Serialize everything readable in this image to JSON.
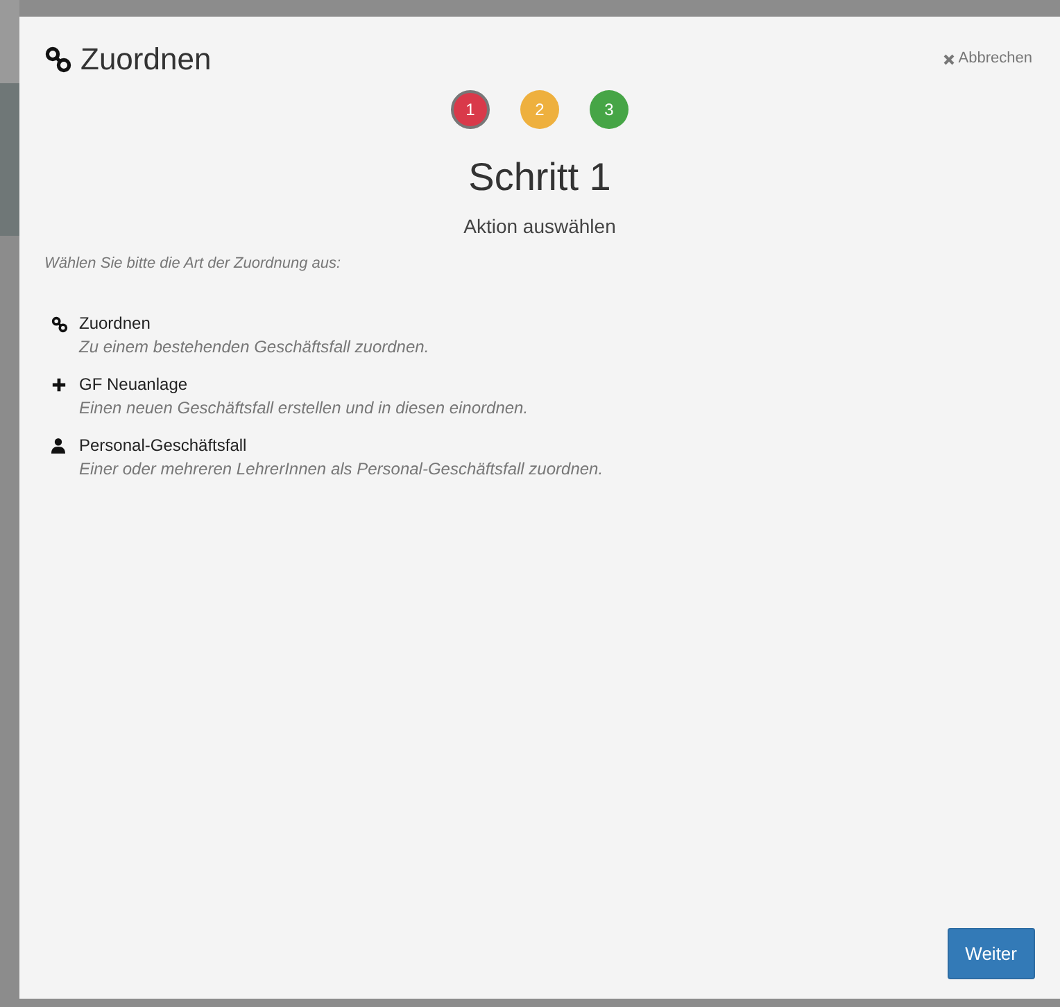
{
  "dialog": {
    "title": "Zuordnen",
    "cancel": "Abbrechen"
  },
  "steps": [
    {
      "label": "1",
      "color": "#d9394a",
      "selected": true
    },
    {
      "label": "2",
      "color": "#eeb03e",
      "selected": false
    },
    {
      "label": "3",
      "color": "#46a546",
      "selected": false
    }
  ],
  "heading": "Schritt 1",
  "subheading": "Aktion auswählen",
  "instruction": "Wählen Sie bitte die Art der Zuordnung aus:",
  "options": [
    {
      "kind": "link",
      "title": "Zuordnen",
      "description": "Zu einem bestehenden Geschäftsfall zuordnen."
    },
    {
      "kind": "plus",
      "title": "GF Neuanlage",
      "description": "Einen neuen Geschäftsfall erstellen und in diesen einordnen."
    },
    {
      "kind": "user",
      "title": "Personal-Geschäftsfall",
      "description": "Einer oder mehreren LehrerInnen als Personal-Geschäftsfall zuordnen."
    }
  ],
  "next_button": "Weiter"
}
